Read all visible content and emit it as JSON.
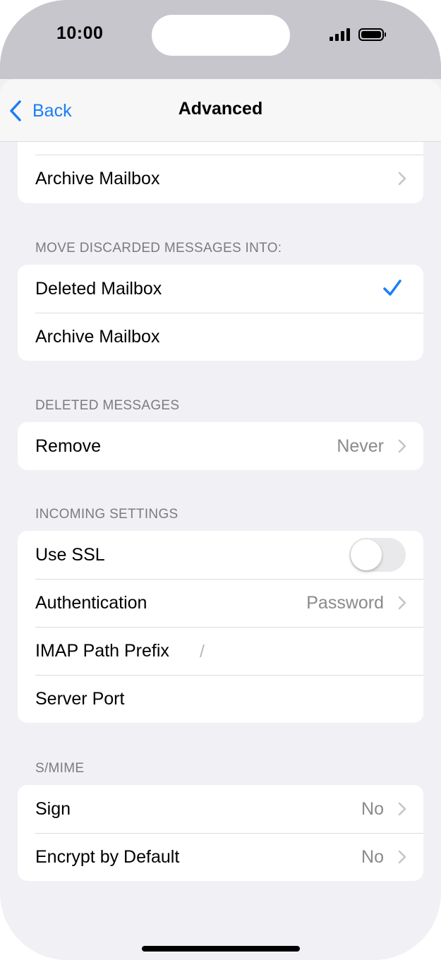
{
  "status_bar": {
    "time": "10:00"
  },
  "nav": {
    "back_label": "Back",
    "title": "Advanced"
  },
  "top_group": {
    "archive_label": "Archive Mailbox"
  },
  "discard": {
    "header": "MOVE DISCARDED MESSAGES INTO:",
    "deleted_label": "Deleted Mailbox",
    "archive_label": "Archive Mailbox",
    "selected": "Deleted Mailbox"
  },
  "deleted_messages": {
    "header": "DELETED MESSAGES",
    "remove_label": "Remove",
    "remove_value": "Never"
  },
  "incoming": {
    "header": "INCOMING SETTINGS",
    "ssl_label": "Use SSL",
    "ssl_on": false,
    "auth_label": "Authentication",
    "auth_value": "Password",
    "imap_label": "IMAP Path Prefix",
    "imap_value": "/",
    "port_label": "Server Port"
  },
  "smime": {
    "header": "S/MIME",
    "sign_label": "Sign",
    "sign_value": "No",
    "encrypt_label": "Encrypt by Default",
    "encrypt_value": "No"
  },
  "colors": {
    "accent": "#1a7ef5",
    "background": "#f1f0f5",
    "secondary_text": "#8a8a8e"
  }
}
